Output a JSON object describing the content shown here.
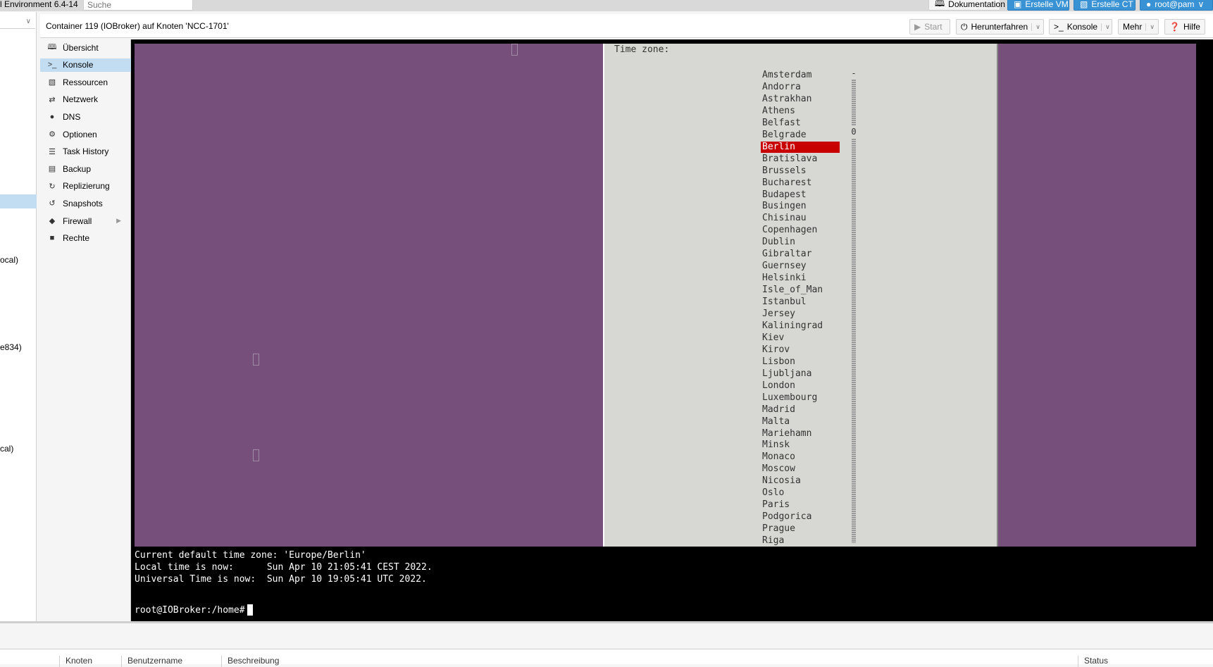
{
  "topbar": {
    "app_title": "l Environment 6.4-14",
    "search_placeholder": "Suche",
    "docs_label": "Dokumentation",
    "create_vm_label": "Erstelle VM",
    "create_ct_label": "Erstelle CT",
    "user_label": "root@pam"
  },
  "tree": {
    "fragments": [
      "ocal)",
      "e834)",
      "cal)"
    ]
  },
  "header": {
    "title": "Container 119 (IOBroker) auf Knoten 'NCC-1701'",
    "start_label": "Start",
    "shutdown_label": "Herunterfahren",
    "console_label": "Konsole",
    "more_label": "Mehr",
    "help_label": "Hilfe"
  },
  "sidenav": {
    "items": [
      {
        "label": "Übersicht",
        "icon": "book-icon"
      },
      {
        "label": "Konsole",
        "icon": "terminal-icon",
        "active": true
      },
      {
        "label": "Ressourcen",
        "icon": "cube-icon"
      },
      {
        "label": "Netzwerk",
        "icon": "exchange-icon"
      },
      {
        "label": "DNS",
        "icon": "globe-icon"
      },
      {
        "label": "Optionen",
        "icon": "gear-icon"
      },
      {
        "label": "Task History",
        "icon": "list-icon"
      },
      {
        "label": "Backup",
        "icon": "floppy-icon"
      },
      {
        "label": "Replizierung",
        "icon": "retweet-icon"
      },
      {
        "label": "Snapshots",
        "icon": "history-icon"
      },
      {
        "label": "Firewall",
        "icon": "shield-icon"
      },
      {
        "label": "Rechte",
        "icon": "unlock-icon"
      }
    ]
  },
  "console": {
    "dialog_title": "Time zone:",
    "timezones": [
      "Amsterdam",
      "Andorra",
      "Astrakhan",
      "Athens",
      "Belfast",
      "Belgrade",
      "Berlin",
      "Bratislava",
      "Brussels",
      "Bucharest",
      "Budapest",
      "Busingen",
      "Chisinau",
      "Copenhagen",
      "Dublin",
      "Gibraltar",
      "Guernsey",
      "Helsinki",
      "Isle_of_Man",
      "Istanbul",
      "Jersey",
      "Kaliningrad",
      "Kiev",
      "Kirov",
      "Lisbon",
      "Ljubljana",
      "London",
      "Luxembourg",
      "Madrid",
      "Malta",
      "Mariehamn",
      "Minsk",
      "Monaco",
      "Moscow",
      "Nicosia",
      "Oslo",
      "Paris",
      "Podgorica",
      "Prague",
      "Riga"
    ],
    "selected_timezone": "Berlin",
    "scrollbar_top_mark": "-",
    "scrollbar_pos_mark": "0",
    "output_lines": [
      "Current default time zone: 'Europe/Berlin'",
      "Local time is now:      Sun Apr 10 21:05:41 CEST 2022.",
      "Universal Time is now:  Sun Apr 10 19:05:41 UTC 2022."
    ],
    "prompt": "root@IOBroker:/home#"
  },
  "bottom": {
    "columns": [
      "Knoten",
      "Benutzername",
      "Beschreibung",
      "Status"
    ]
  },
  "colors": {
    "console_bg": "#764f7a",
    "dialog_bg": "#d7d7d3",
    "selection": "#c80000",
    "accent": "#3892d4",
    "nav_active": "#c2ddf2"
  }
}
